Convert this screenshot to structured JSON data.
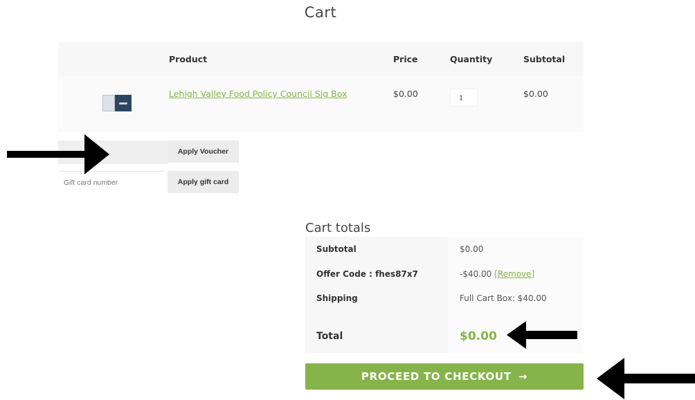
{
  "page": {
    "title": "Cart"
  },
  "cart_table": {
    "headers": {
      "product": "Product",
      "price": "Price",
      "quantity": "Quantity",
      "subtotal": "Subtotal"
    },
    "rows": [
      {
        "thumbnail_icon": "product-thumbnail",
        "product": "Lehigh Valley Food Policy Council Sig Box",
        "price": "$0.00",
        "quantity": "1",
        "subtotal": "$0.00"
      }
    ]
  },
  "coupon": {
    "voucher_placeholder": "",
    "voucher_button": "Apply Voucher",
    "giftcard_placeholder": "Gift card number",
    "giftcard_button": "Apply gift card"
  },
  "totals": {
    "title": "Cart totals",
    "subtotal_label": "Subtotal",
    "subtotal_value": "$0.00",
    "offer_label": "Offer Code : fhes87x7",
    "offer_value": "-$40.00",
    "offer_remove": "[Remove]",
    "shipping_label": "Shipping",
    "shipping_value": "Full Cart Box: $40.00",
    "total_label": "Total",
    "total_value": "$0.00"
  },
  "checkout": {
    "label": "PROCEED TO CHECKOUT",
    "arrow": "→"
  },
  "colors": {
    "accent": "#86b34a",
    "annotation_arrow": "#000000"
  }
}
